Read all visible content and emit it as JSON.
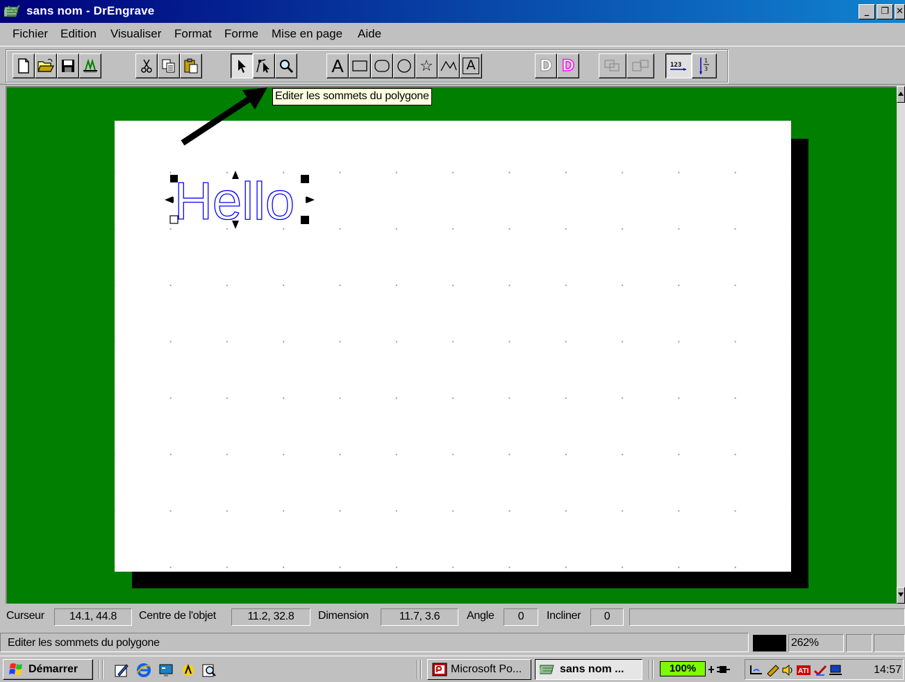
{
  "window": {
    "title": "sans nom - DrEngrave",
    "minimize_glyph": "_",
    "maximize_glyph": "❐",
    "close_glyph": "✕"
  },
  "menu": [
    {
      "label": "Fichier"
    },
    {
      "label": "Edition"
    },
    {
      "label": "Visualiser"
    },
    {
      "label": "Format"
    },
    {
      "label": "Forme"
    },
    {
      "label": "Mise en page"
    },
    {
      "label": "Aide"
    }
  ],
  "toolbar": {
    "buttons": [
      {
        "icon": "new-file-icon"
      },
      {
        "icon": "open-folder-icon"
      },
      {
        "icon": "save-icon"
      },
      {
        "icon": "engrave-icon"
      },
      {
        "icon": "cut-icon"
      },
      {
        "icon": "copy-icon"
      },
      {
        "icon": "paste-icon"
      },
      {
        "icon": "select-arrow-icon",
        "active": true
      },
      {
        "icon": "edit-vertices-icon"
      },
      {
        "icon": "zoom-icon"
      },
      {
        "icon": "text-tool-icon",
        "glyph": "A"
      },
      {
        "icon": "rectangle-tool-icon"
      },
      {
        "icon": "rounded-rect-tool-icon"
      },
      {
        "icon": "ellipse-tool-icon"
      },
      {
        "icon": "star-tool-icon",
        "glyph": "☆"
      },
      {
        "icon": "polyline-tool-icon"
      },
      {
        "icon": "framed-text-icon",
        "glyph": "A"
      },
      {
        "icon": "d-outline-icon",
        "glyph": "D"
      },
      {
        "icon": "d-magenta-icon",
        "glyph": "D"
      },
      {
        "icon": "group-icon"
      },
      {
        "icon": "ungroup-icon"
      },
      {
        "icon": "numbering-icon",
        "glyph": "123"
      },
      {
        "icon": "fraction-icon"
      }
    ]
  },
  "tooltip": "Editer les sommets du polygone",
  "canvas": {
    "text_object": "Hello",
    "text_color": "#0000ff",
    "workspace_color": "#007f00"
  },
  "statusbar": {
    "cursor_label": "Curseur",
    "cursor_value": "14.1, 44.8",
    "center_label": "Centre de l'objet",
    "center_value": "11.2, 32.8",
    "dimension_label": "Dimension",
    "dimension_value": "11.7, 3.6",
    "angle_label": "Angle",
    "angle_value": "0",
    "incliner_label": "Incliner",
    "incliner_value": "0",
    "message": "Editer les sommets du polygone",
    "zoom": "262%"
  },
  "taskbar": {
    "start_label": "Démarrer",
    "tasks": [
      {
        "label": "Microsoft Po...",
        "icon": "powerpoint-icon"
      },
      {
        "label": "sans nom ...",
        "icon": "drengrave-icon",
        "active": true
      }
    ],
    "tray_zoom": "100%",
    "clock": "14:57"
  }
}
